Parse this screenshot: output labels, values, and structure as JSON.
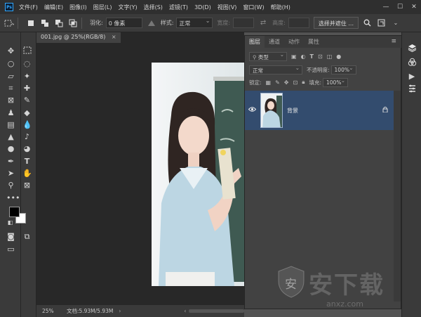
{
  "menu": {
    "logo": "Ps",
    "items": [
      "文件(F)",
      "编辑(E)",
      "图像(I)",
      "图层(L)",
      "文字(Y)",
      "选择(S)",
      "滤镜(T)",
      "3D(D)",
      "视图(V)",
      "窗口(W)",
      "帮助(H)"
    ],
    "window_controls": [
      "—",
      "☐",
      "✕"
    ]
  },
  "options": {
    "feather_label": "羽化:",
    "feather_value": "0 像素",
    "style_label": "样式:",
    "style_value": "正常",
    "width_label": "宽度:",
    "height_label": "高度:",
    "select_mask_button": "选择并遮住 ..."
  },
  "document": {
    "tab_title": "001.jpg @ 25%(RGB/8)",
    "tab_close": "×",
    "zoom": "25%",
    "doc_info": "文档:5.93M/5.93M",
    "status_arrow": "›"
  },
  "layers_panel": {
    "tabs": [
      "图层",
      "通道",
      "动作",
      "属性"
    ],
    "filter_value": "类型",
    "blend_mode": "正常",
    "opacity_label": "不透明度:",
    "opacity_value": "100%",
    "lock_label": "锁定:",
    "fill_label": "填充:",
    "fill_value": "100%",
    "layers": [
      {
        "name": "背景",
        "visible": true,
        "locked": true
      }
    ]
  },
  "watermark": {
    "glyph": "安",
    "text": "安下载",
    "sub": "anxz.com"
  },
  "colors": {
    "foreground": "#000000",
    "background": "#ffffff",
    "selected_layer": "#334c6e",
    "ps_blue": "#31a8ff"
  }
}
